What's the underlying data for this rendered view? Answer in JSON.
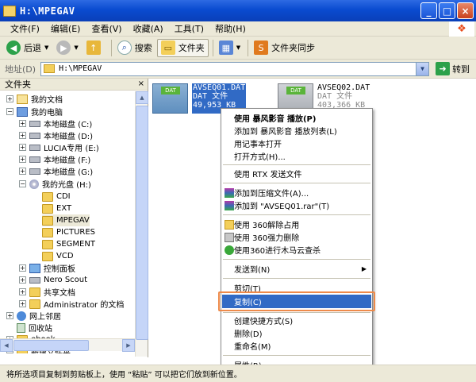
{
  "window": {
    "title": "H:\\MPEGAV"
  },
  "menubar": [
    "文件(F)",
    "编辑(E)",
    "查看(V)",
    "收藏(A)",
    "工具(T)",
    "帮助(H)"
  ],
  "toolbar": {
    "back": "后退",
    "search": "搜索",
    "folders": "文件夹",
    "sync": "文件夹同步"
  },
  "address": {
    "label": "地址(D)",
    "value": "H:\\MPEGAV",
    "go": "转到"
  },
  "pane": {
    "title": "文件夹",
    "close": "×"
  },
  "tree": [
    "我的文档",
    "我的电脑",
    "本地磁盘 (C:)",
    "本地磁盘 (D:)",
    "LUCIA专用 (E:)",
    "本地磁盘 (F:)",
    "本地磁盘 (G:)",
    "我的光盘 (H:)",
    "CDI",
    "EXT",
    "MPEGAV",
    "PICTURES",
    "SEGMENT",
    "VCD",
    "控制面板",
    "Nero Scout",
    "共享文档",
    "Administrator 的文档",
    "网上邻居",
    "回收站",
    "ebook",
    "新建文件夹"
  ],
  "files": [
    {
      "name": "AVSEQ01.DAT",
      "type": "DAT 文件",
      "size": "49,953 KB",
      "tag": "DAT"
    },
    {
      "name": "AVSEQ02.DAT",
      "type": "DAT 文件",
      "size": "403,366 KB",
      "tag": "DAT"
    }
  ],
  "context_menu": [
    "使用 暴风影音 播放(P)",
    "添加到 暴风影音 播放列表(L)",
    "用记事本打开",
    "打开方式(H)...",
    "使用 RTX 发送文件",
    "添加到压缩文件(A)...",
    "添加到 \"AVSEQ01.rar\"(T)",
    "使用 360解除占用",
    "使用 360强力删除",
    "使用360进行木马云查杀",
    "发送到(N)",
    "剪切(T)",
    "复制(C)",
    "创建快捷方式(S)",
    "删除(D)",
    "重命名(M)",
    "属性(R)"
  ],
  "statusbar": "将所选项目复制到剪贴板上，使用 “粘贴” 可以把它们放到新位置。",
  "colors": {
    "title_blue": "#0a4bd0",
    "selection": "#316ac5",
    "highlight_box": "#ee8a4a"
  }
}
